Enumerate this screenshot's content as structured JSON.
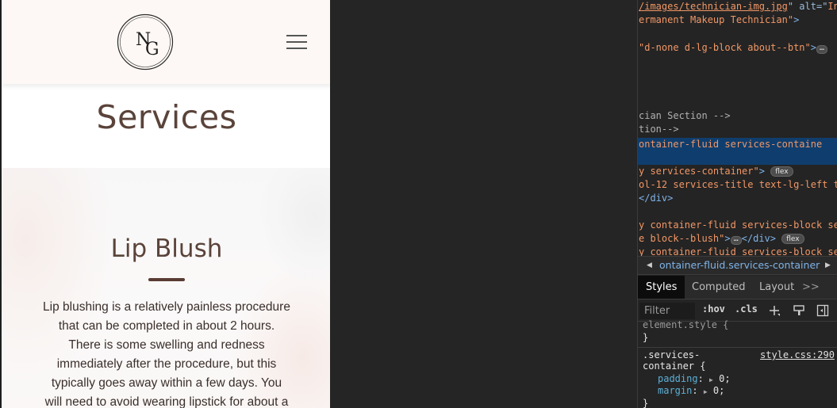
{
  "site": {
    "logo_text": "NG",
    "services_title": "Services",
    "blush": {
      "title": "Lip Blush",
      "lines": [
        "Lip blushing is a relatively painless procedure",
        "that can be completed in about 2 hours.",
        "There is some swelling and redness",
        "immediately after the procedure, but this",
        "typically goes away within a few days. You",
        "will need to avoid wearing lipstick for about a"
      ]
    }
  },
  "devtools": {
    "dom": [
      {
        "parts": [
          [
            "attrv",
            "/images/technician-img.jpg",
            true
          ],
          [
            "attr",
            "\" alt=\""
          ],
          [
            "attrv",
            "In"
          ]
        ]
      },
      {
        "parts": [
          [
            "attrv",
            "ermanent Makeup Technician\""
          ],
          [
            "tag",
            ">"
          ]
        ]
      },
      {
        "parts": [
          [
            "attrv",
            "\"d-none d-lg-block about--btn\""
          ],
          [
            "tag",
            ">"
          ]
        ],
        "ellipsis": true
      },
      {
        "parts": [
          [
            "comment",
            "cian Section -->"
          ]
        ]
      },
      {
        "parts": [
          [
            "comment",
            "tion-->"
          ]
        ]
      },
      {
        "parts": [
          [
            "attrv",
            "ontainer-fluid services-containe"
          ]
        ],
        "selected": true
      },
      {
        "parts": [
          [
            "attrv",
            "y services-container\""
          ],
          [
            "tag",
            ">"
          ]
        ],
        "badge": "flex"
      },
      {
        "parts": [
          [
            "attrv",
            "ol-12 services-title text-lg-left t"
          ]
        ]
      },
      {
        "parts": [
          [
            "tag",
            "</div>"
          ]
        ]
      },
      {
        "parts": [
          [
            "attrv",
            "y container-fluid services-block se"
          ]
        ]
      },
      {
        "parts": [
          [
            "attrv",
            "e block--blush\""
          ],
          [
            "tag",
            ">"
          ]
        ],
        "ellipsis": true,
        "after": "</div>",
        "badge": "flex"
      },
      {
        "parts": [
          [
            "attrv",
            "y container-fluid services-block se"
          ]
        ]
      }
    ],
    "breadcrumb": "ontainer-fluid.services-container",
    "tabs": [
      "Styles",
      "Computed",
      "Layout"
    ],
    "more_tabs": ">>",
    "filter_placeholder": "Filter",
    "hov": ":hov",
    "cls": ".cls",
    "styles": {
      "element_style_partial": "element.style {",
      "close_brace": "}",
      "selector_line1": ".services-",
      "selector_line2": "container {",
      "source": "style.css:290",
      "props": [
        {
          "name": "padding",
          "value": "0;"
        },
        {
          "name": "margin",
          "value": "0;"
        }
      ]
    }
  },
  "colors": {
    "brown_heading": "#5a433a",
    "selected_row": "#0f3e6e",
    "devtools_bg": "#242424"
  }
}
